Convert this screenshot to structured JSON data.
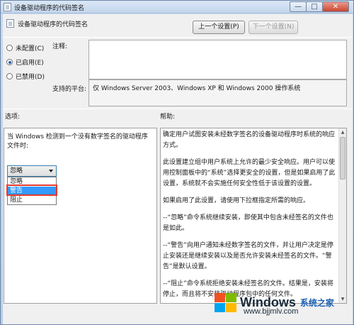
{
  "window": {
    "title": "设备驱动程序的代码签名"
  },
  "header": {
    "policy_name": "设备驱动程序的代码签名",
    "prev_button": "上一个设置(P)",
    "next_button": "下一个设置(N)"
  },
  "state": {
    "options": [
      "未配置(C)",
      "已启用(E)",
      "已禁用(D)"
    ],
    "selected": "已启用(E)"
  },
  "comment": {
    "label": "注释:",
    "value": ""
  },
  "platform": {
    "label": "支持的平台:",
    "value": "仅 Windows Server 2003、Windows XP 和 Windows 2000 操作系统"
  },
  "sections": {
    "options_label": "选项:",
    "help_label": "帮助:"
  },
  "options_panel": {
    "description": "当 Windows 检测到一个没有数字签名的驱动程序文件时:",
    "dropdown_value": "忽略",
    "dropdown_items": [
      "忽略",
      "警告",
      "阻止"
    ],
    "highlighted_item": "警告"
  },
  "help_panel": {
    "paragraphs": [
      "确定用户试图安装未经数字签名的设备驱动程序时系统的响应方式。",
      "此设置建立组中用户系统上允许的最少安全响应。用户可以使用控制面板中的“系统”选择更安全的设置，但是如果启用了此设置，系统就不会实施任何安全性低于该设置的设置。",
      "如果启用了此设置，请使用下拉框指定所需的响应。",
      "--“忽略”命令系统继续安装，即使其中包含未经签名的文件也是如此。",
      "--“警告”向用户通知未经数字签名的文件，并让用户决定是停止安装还是继续安装以及是否允许安装未经签名的文件。“警告”是默认设置。",
      "--“阻止”命令系统拒绝安装未经签名的文件。结果是，安装将停止，而且将不安装驱动程序包中的任何文件。"
    ]
  },
  "watermark": {
    "brand": "Windows",
    "cn": "系统之家",
    "url": "www.bjjmlv.com"
  }
}
